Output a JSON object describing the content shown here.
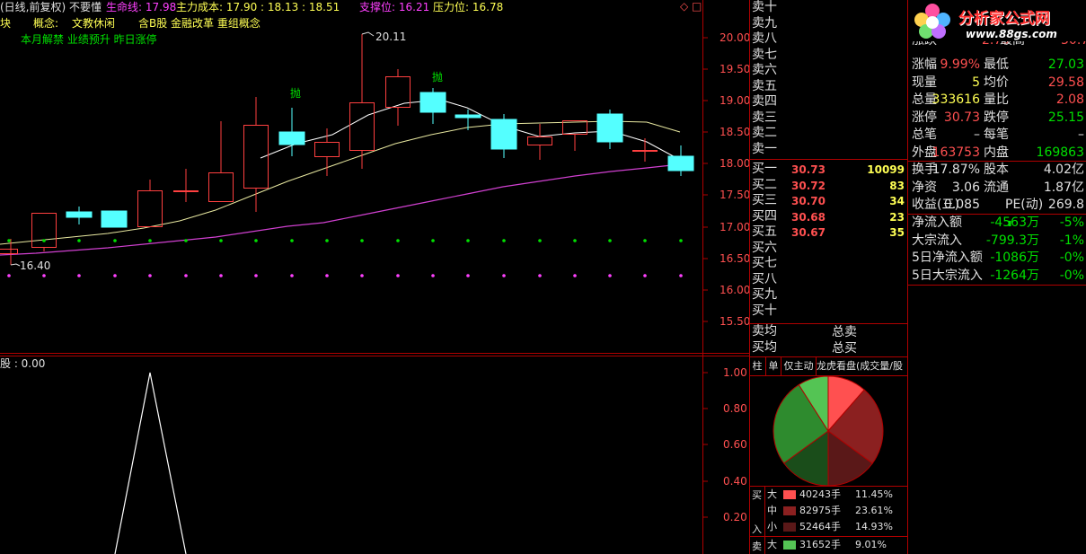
{
  "header": {
    "title": "(日线,前复权) 不要懂",
    "lifeline_label": "生命线: 17.98",
    "cost_label": "主力成本: 17.90 : 18.13 : 18.51",
    "support_label": "支撑位: 16.21",
    "pressure_label": "压力位: 16.78",
    "icons": "◇ □"
  },
  "concept_row": {
    "prefix": "块",
    "label": "概念:",
    "tags": "文教休闲",
    "tags2": "含B股 金融改革 重组概念"
  },
  "tag_row": "本月解禁 业绩预升 昨日涨停",
  "kline": {
    "high_label": "20.11",
    "low_label": "16.40",
    "sell_marks": [
      "抛",
      "抛"
    ],
    "price_ticks": [
      "20.00",
      "19.50",
      "19.00",
      "18.50",
      "18.00",
      "17.50",
      "17.00",
      "16.50",
      "16.00",
      "15.50"
    ]
  },
  "sub_chart": {
    "label": "股 : 0.00",
    "ticks": [
      "1.00",
      "0.80",
      "0.60",
      "0.40",
      "0.20"
    ]
  },
  "orderbook": {
    "sell_labels": [
      "卖十",
      "卖九",
      "卖八",
      "卖七",
      "卖六",
      "卖五",
      "卖四",
      "卖三",
      "卖二",
      "卖一"
    ],
    "buy_rows": [
      {
        "label": "买一",
        "price": "30.73",
        "vol": "10099"
      },
      {
        "label": "买二",
        "price": "30.72",
        "vol": "83"
      },
      {
        "label": "买三",
        "price": "30.70",
        "vol": "34"
      },
      {
        "label": "买四",
        "price": "30.68",
        "vol": "23"
      },
      {
        "label": "买五",
        "price": "30.67",
        "vol": "35"
      },
      {
        "label": "买六",
        "price": "",
        "vol": ""
      },
      {
        "label": "买七",
        "price": "",
        "vol": ""
      },
      {
        "label": "买八",
        "price": "",
        "vol": ""
      },
      {
        "label": "买九",
        "price": "",
        "vol": ""
      },
      {
        "label": "买十",
        "price": "",
        "vol": ""
      }
    ],
    "avg_sell": "卖均",
    "avg_buy": "买均",
    "total_sell": "总卖",
    "total_buy": "总买"
  },
  "logo": {
    "title": "分析家公式网",
    "url": "www.88gs.com"
  },
  "quote": {
    "partial_row": {
      "l1": "涨跌",
      "v1": "2.79",
      "l2": "最高",
      "v2": "30.73"
    },
    "rows": [
      {
        "l1": "涨幅",
        "v1": "9.99%",
        "l2": "最低",
        "v2": "27.03",
        "c1": "red",
        "c2": "grn"
      },
      {
        "l1": "现量",
        "v1": "5",
        "l2": "均价",
        "v2": "29.58",
        "c1": "ylw",
        "c2": "red"
      },
      {
        "l1": "总量",
        "v1": "333616",
        "l2": "量比",
        "v2": "2.08",
        "c1": "ylw",
        "c2": "red"
      },
      {
        "l1": "涨停",
        "v1": "30.73",
        "l2": "跌停",
        "v2": "25.15",
        "c1": "red",
        "c2": "grn"
      },
      {
        "l1": "总笔",
        "v1": "–",
        "l2": "每笔",
        "v2": "–",
        "c1": "wht",
        "c2": "wht"
      },
      {
        "l1": "外盘",
        "v1": "163753",
        "l2": "内盘",
        "v2": "169863",
        "c1": "red",
        "c2": "grn"
      },
      {
        "l1": "换手",
        "v1": "17.87%",
        "l2": "股本",
        "v2": "4.02亿",
        "c1": "wht",
        "c2": "wht"
      },
      {
        "l1": "净资",
        "v1": "3.06",
        "l2": "流通",
        "v2": "1.87亿",
        "c1": "wht",
        "c2": "wht"
      },
      {
        "l1": "收益(三)",
        "v1": "0.085",
        "l2": "PE(动)",
        "v2": "269.8",
        "c1": "wht",
        "c2": "wht"
      }
    ],
    "flows": [
      {
        "label": "净流入额",
        "val": "-4563万",
        "pct": "-5%"
      },
      {
        "label": "大宗流入",
        "val": "-799.3万",
        "pct": "-1%"
      },
      {
        "label": "5日净流入额",
        "val": "-1086万",
        "pct": "-0%"
      },
      {
        "label": "5日大宗流入",
        "val": "-1264万",
        "pct": "-0%"
      }
    ]
  },
  "tabs": [
    "柱",
    "单",
    "仅主动",
    "龙虎看盘(成交量/股"
  ],
  "pie": {
    "slices": [
      {
        "name": "买入大",
        "pct": 11.45,
        "color": "#ff5050"
      },
      {
        "name": "买入中",
        "pct": 23.61,
        "color": "#8b2020"
      },
      {
        "name": "买入小",
        "pct": 14.93,
        "color": "#5a1818"
      },
      {
        "name": "卖出小",
        "pct": 15.0,
        "color": "#1a4d1a"
      },
      {
        "name": "卖出中",
        "pct": 26.0,
        "color": "#2e8b2e"
      },
      {
        "name": "卖出大",
        "pct": 9.01,
        "color": "#54c454"
      }
    ]
  },
  "legend": {
    "buy_side": "买",
    "in_char": "入",
    "sell_side": "卖",
    "rows": [
      {
        "size": "大",
        "color": "#ff5050",
        "vol": "40243手",
        "pct": "11.45%"
      },
      {
        "size": "中",
        "color": "#8b2020",
        "vol": "82975手",
        "pct": "23.61%"
      },
      {
        "size": "小",
        "color": "#5a1818",
        "vol": "52464手",
        "pct": "14.93%"
      },
      {
        "size": "大",
        "color": "#54c454",
        "vol": "31652手",
        "pct": "9.01%"
      }
    ]
  }
}
